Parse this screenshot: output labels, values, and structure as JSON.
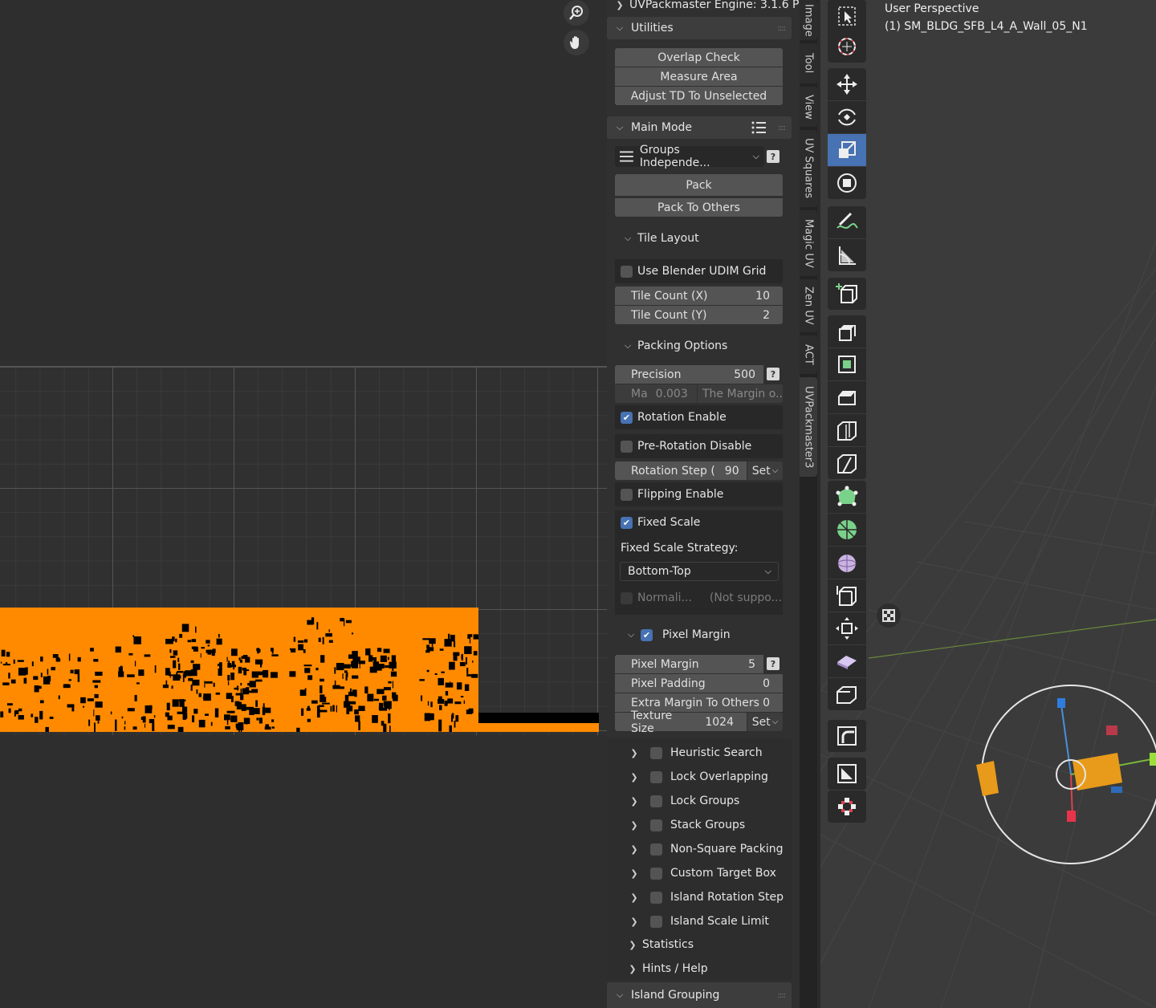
{
  "uv_editor": {
    "zoom_icon": "zoom-in-icon",
    "pan_icon": "hand-icon"
  },
  "npanel": {
    "engine_header": "UVPackmaster Engine: 3.1.6 P",
    "utilities": {
      "title": "Utilities",
      "buttons": [
        "Overlap Check",
        "Measure Area",
        "Adjust TD To Unselected"
      ]
    },
    "main_mode": {
      "title": "Main Mode",
      "mode_value": "Groups Independe...",
      "pack_label": "Pack",
      "pack_others_label": "Pack To Others"
    },
    "tile_layout": {
      "title": "Tile Layout",
      "udim_label": "Use Blender UDIM Grid",
      "udim_checked": false,
      "tile_x_label": "Tile Count (X)",
      "tile_x_value": "10",
      "tile_y_label": "Tile Count (Y)",
      "tile_y_value": "2"
    },
    "packing_options": {
      "title": "Packing Options",
      "precision_label": "Precision",
      "precision_value": "500",
      "margin_label": "Ma",
      "margin_value": "0.003",
      "margin_note": "The Margin o...",
      "rotation_enable_label": "Rotation Enable",
      "rotation_enable_checked": true,
      "prerotation_label": "Pre-Rotation Disable",
      "prerotation_checked": false,
      "rotation_step_label": "Rotation Step (",
      "rotation_step_value": "90",
      "set_label": "Set",
      "flipping_label": "Flipping Enable",
      "flipping_checked": false,
      "fixed_scale_label": "Fixed Scale",
      "fixed_scale_checked": true,
      "strategy_label": "Fixed Scale Strategy:",
      "strategy_value": "Bottom-Top",
      "normalize_label": "Normali...",
      "normalize_note": "(Not suppo..."
    },
    "pixel_margin": {
      "title": "Pixel Margin",
      "checked": true,
      "margin_label": "Pixel Margin",
      "margin_value": "5",
      "padding_label": "Pixel Padding",
      "padding_value": "0",
      "extra_label": "Extra Margin To Others",
      "extra_value": "0",
      "texture_label": "Texture Size",
      "texture_value": "1024",
      "set_label": "Set"
    },
    "options": [
      "Heuristic Search",
      "Lock Overlapping",
      "Lock Groups",
      "Stack Groups",
      "Non-Square Packing",
      "Custom Target Box",
      "Island Rotation Step",
      "Island Scale Limit"
    ],
    "statistics_label": "Statistics",
    "hints_label": "Hints / Help",
    "island_grouping_title": "Island Grouping"
  },
  "tabs": [
    "Image",
    "Tool",
    "View",
    "UV Squares",
    "Magic UV",
    "Zen UV",
    "ACT",
    "UVPackmaster3"
  ],
  "viewport": {
    "title": "User Perspective",
    "object": "(1) SM_BLDG_SFB_L4_A_Wall_05_N1"
  },
  "tools": [
    "select-box-icon",
    "cursor-icon",
    "move-icon",
    "rotate-icon",
    "scale-icon",
    "transform-icon",
    "annotate-icon",
    "measure-icon",
    "add-cube-icon",
    "extrude-icon",
    "inset-icon",
    "bevel-icon",
    "loop-cut-icon",
    "knife-icon",
    "poly-build-icon",
    "spin-icon",
    "smooth-icon",
    "edge-slide-icon",
    "shrink-fatten-icon",
    "shear-icon",
    "rip-icon",
    "uv-tool-a-icon",
    "uv-tool-b-icon",
    "uv-tool-c-icon"
  ],
  "colors": {
    "accent": "#4772b3",
    "uv_islands": "#ff8a00",
    "panel_bg": "#303030"
  }
}
